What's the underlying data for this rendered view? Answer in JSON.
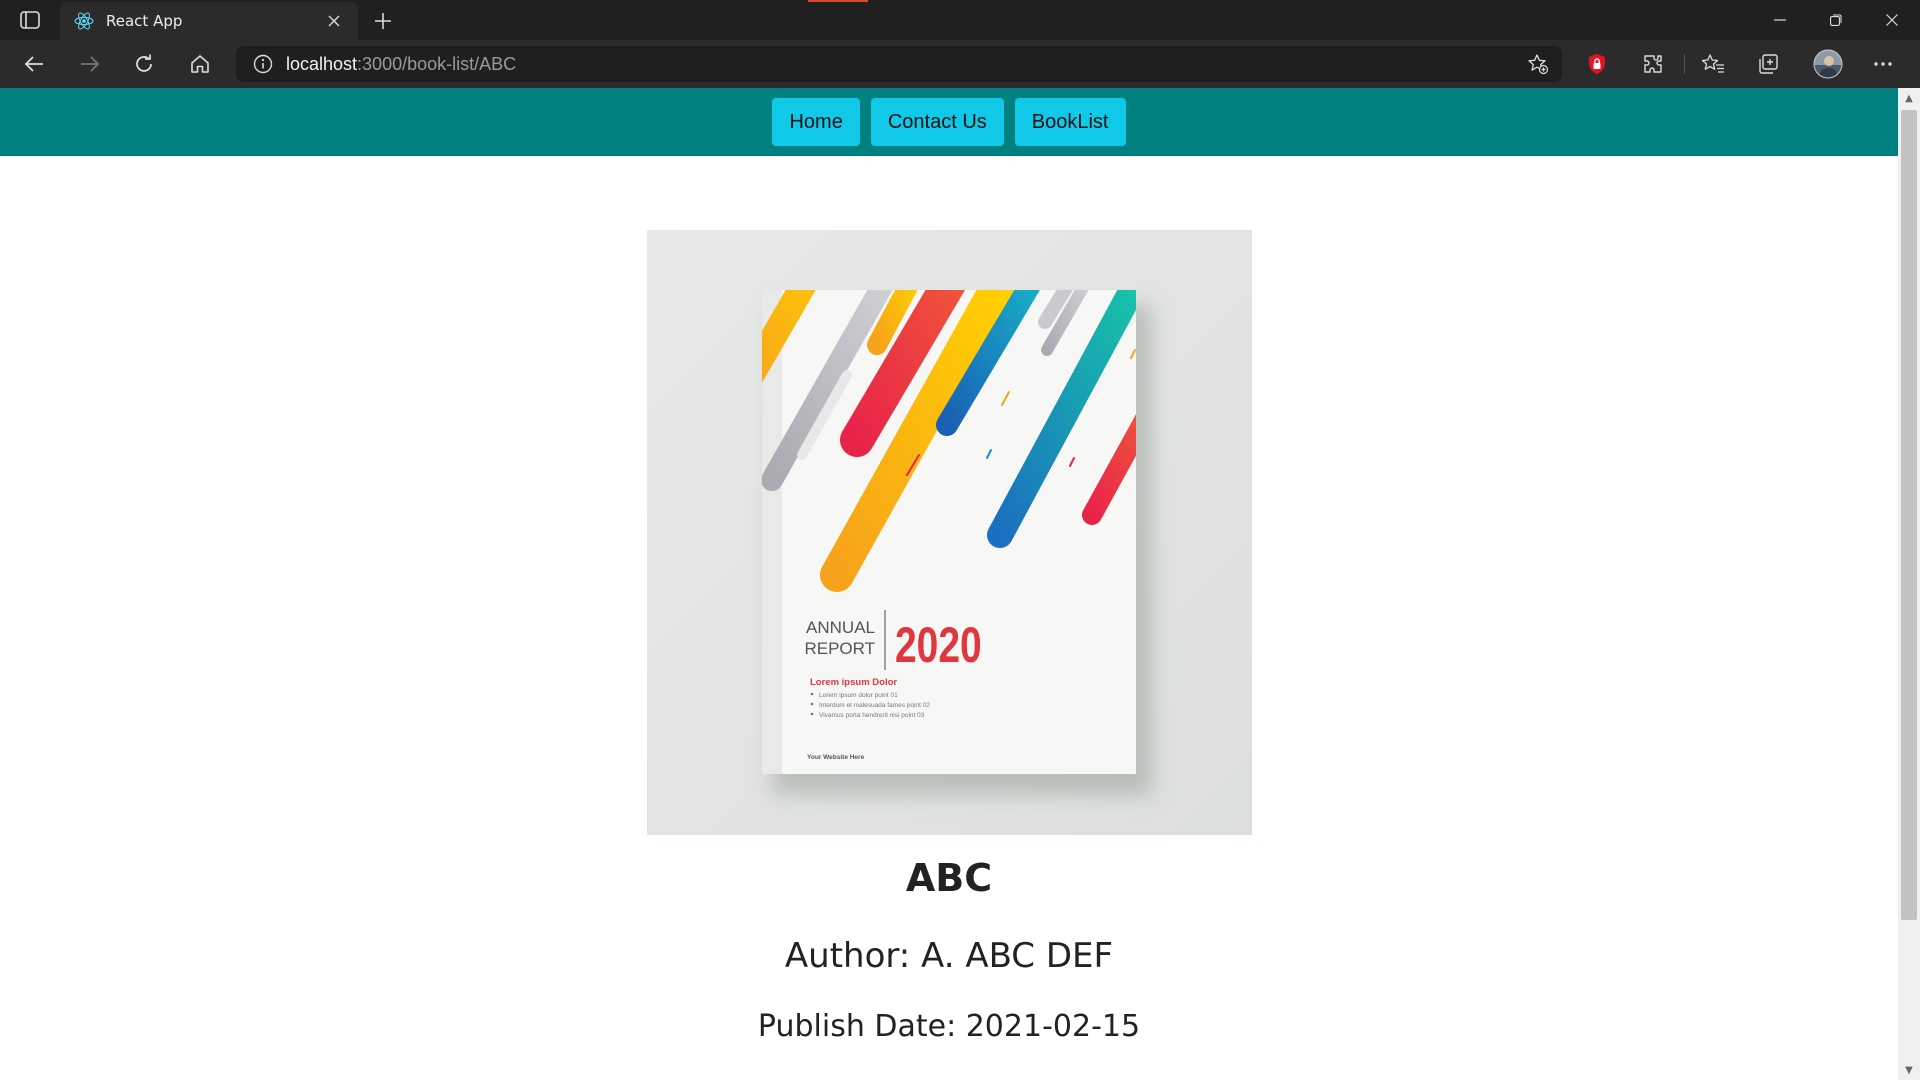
{
  "browser": {
    "tab_title": "React App",
    "url_host": "localhost",
    "url_rest": ":3000/book-list/ABC"
  },
  "nav": {
    "home_label": "Home",
    "contact_label": "Contact Us",
    "booklist_label": "BookList"
  },
  "cover": {
    "line1": "ANNUAL",
    "line2": "REPORT",
    "year": "2020",
    "subtitle": "Lorem ipsum Dolor",
    "bullets": [
      "Lorem ipsum dolor point 01",
      "Interdum et malesuada fames point 02",
      "Vivamus porta hendrerit nisi point 03"
    ],
    "website": "Your Website Here"
  },
  "book": {
    "title": "ABC",
    "author": "Author: A. ABC DEF",
    "publish_date": "Publish Date: 2021-02-15"
  },
  "colors": {
    "nav_bg": "#008080",
    "nav_button": "#10c8e8",
    "cover_year": "#e0363e"
  }
}
